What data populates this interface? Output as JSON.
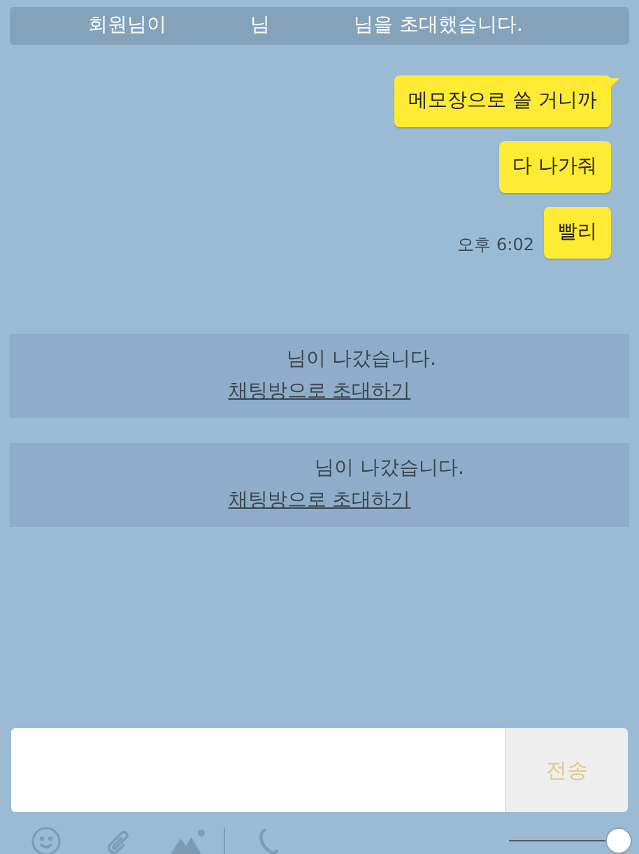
{
  "header": {
    "parts": [
      "회원님이",
      "님",
      "님을 초대했습니다."
    ]
  },
  "messages": [
    {
      "text": "메모장으로 쓸 거니까",
      "tail": true
    },
    {
      "text": "다 나가줘",
      "tail": false
    },
    {
      "text": "빨리",
      "tail": false,
      "time": "오후 6:02"
    }
  ],
  "notices": [
    {
      "text": "님이 나갔습니다.",
      "link": "채팅방으로 초대하기"
    },
    {
      "text": "님이 나갔습니다.",
      "link": "채팅방으로 초대하기"
    }
  ],
  "composer": {
    "send_label": "전송"
  },
  "opacity_slider": {
    "level": 1
  }
}
